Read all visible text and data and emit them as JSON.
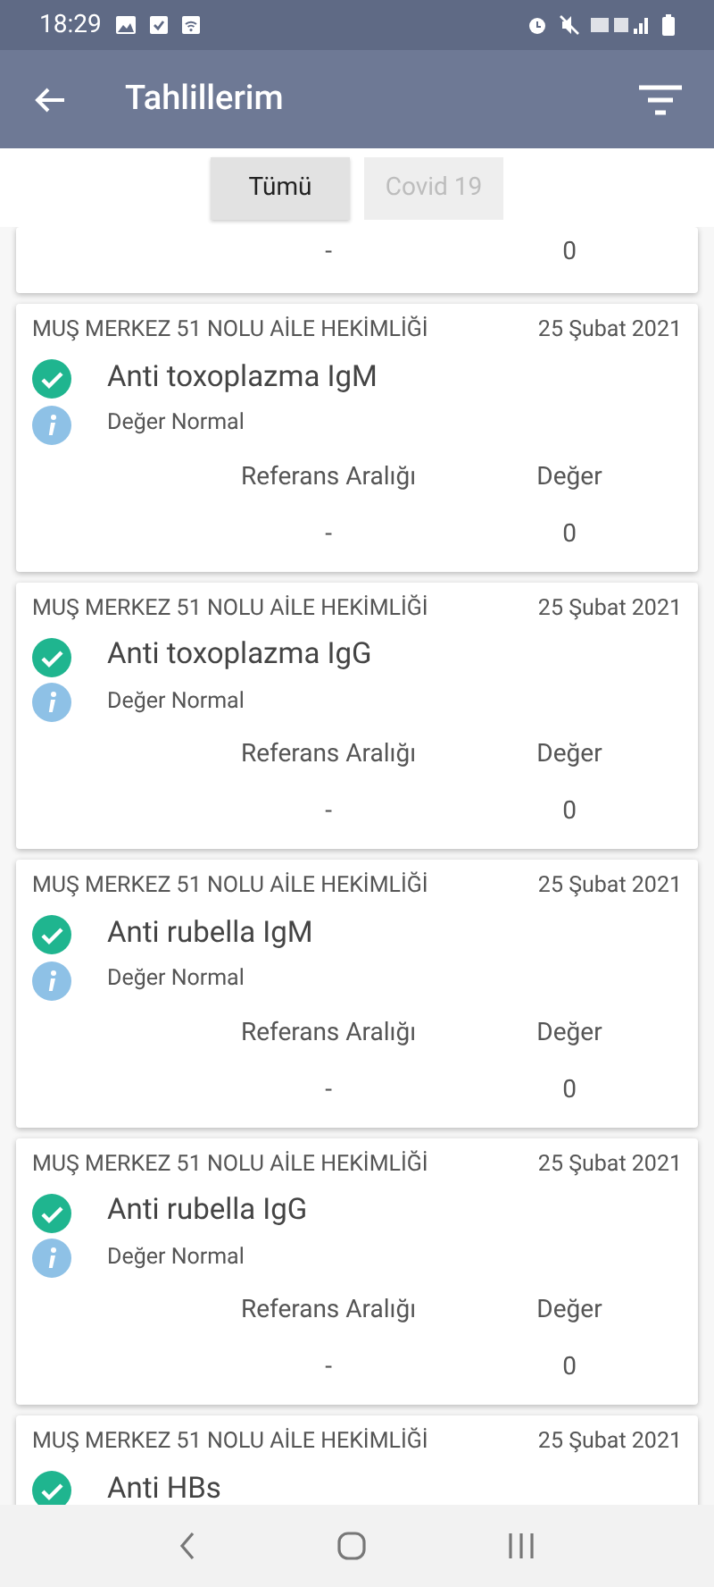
{
  "status_bar": {
    "time": "18:29"
  },
  "app_bar": {
    "title": "Tahlillerim"
  },
  "filters": [
    {
      "label": "Tümü",
      "selected": true
    },
    {
      "label": "Covid 19",
      "selected": false
    }
  ],
  "results": [
    {
      "kind": "tail",
      "reference": "-",
      "value": "0"
    },
    {
      "kind": "full",
      "clinic": "MUŞ MERKEZ 51 NOLU AİLE HEKİMLİĞİ",
      "date": "25 Şubat 2021",
      "test": "Anti toxoplazma IgM",
      "status": "Değer Normal",
      "reference_label": "Referans Aralığı",
      "value_label": "Değer",
      "reference": "-",
      "value": "0"
    },
    {
      "kind": "full",
      "clinic": "MUŞ MERKEZ 51 NOLU AİLE HEKİMLİĞİ",
      "date": "25 Şubat 2021",
      "test": "Anti toxoplazma IgG",
      "status": "Değer Normal",
      "reference_label": "Referans Aralığı",
      "value_label": "Değer",
      "reference": "-",
      "value": "0"
    },
    {
      "kind": "full",
      "clinic": "MUŞ MERKEZ 51 NOLU AİLE HEKİMLİĞİ",
      "date": "25 Şubat 2021",
      "test": "Anti rubella IgM",
      "status": "Değer Normal",
      "reference_label": "Referans Aralığı",
      "value_label": "Değer",
      "reference": "-",
      "value": "0"
    },
    {
      "kind": "full",
      "clinic": "MUŞ MERKEZ 51 NOLU AİLE HEKİMLİĞİ",
      "date": "25 Şubat 2021",
      "test": "Anti rubella IgG",
      "status": "Değer Normal",
      "reference_label": "Referans Aralığı",
      "value_label": "Değer",
      "reference": "-",
      "value": "0"
    },
    {
      "kind": "head",
      "clinic": "MUŞ MERKEZ 51 NOLU AİLE HEKİMLİĞİ",
      "date": "25 Şubat 2021",
      "test": "Anti HBs"
    }
  ]
}
